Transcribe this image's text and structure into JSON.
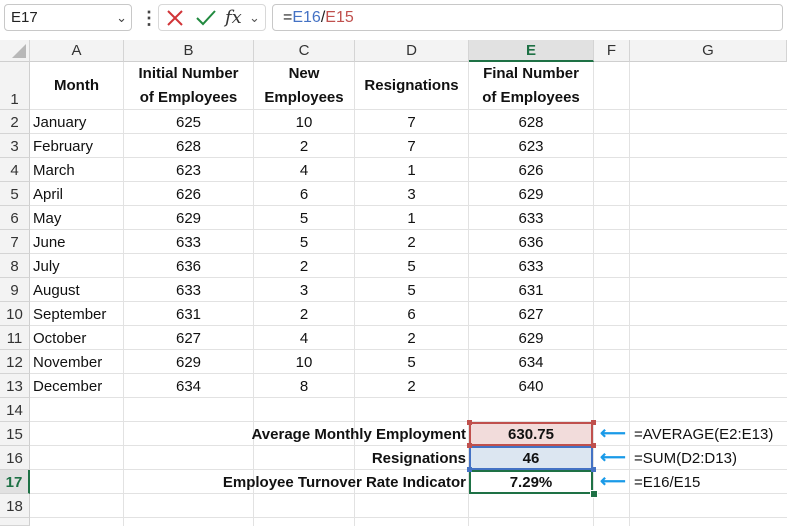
{
  "formula_bar": {
    "name_box": "E17",
    "formula": "=E16/E15",
    "formula_parts": {
      "eq": "=",
      "ref1": "E16",
      "op": "/",
      "ref2": "E15"
    }
  },
  "columns": [
    "A",
    "B",
    "C",
    "D",
    "E",
    "F",
    "G"
  ],
  "rows": [
    "1",
    "2",
    "3",
    "4",
    "5",
    "6",
    "7",
    "8",
    "9",
    "10",
    "11",
    "12",
    "13",
    "14",
    "15",
    "16",
    "17",
    "18"
  ],
  "table": {
    "headers": {
      "month": "Month",
      "initial_l1": "Initial Number",
      "initial_l2": "of Employees",
      "new_l1": "New",
      "new_l2": "Employees",
      "resignations": "Resignations",
      "final_l1": "Final Number",
      "final_l2": "of Employees"
    },
    "data": [
      [
        "January",
        "625",
        "10",
        "7",
        "628"
      ],
      [
        "February",
        "628",
        "2",
        "7",
        "623"
      ],
      [
        "March",
        "623",
        "4",
        "1",
        "626"
      ],
      [
        "April",
        "626",
        "6",
        "3",
        "629"
      ],
      [
        "May",
        "629",
        "5",
        "1",
        "633"
      ],
      [
        "June",
        "633",
        "5",
        "2",
        "636"
      ],
      [
        "July",
        "636",
        "2",
        "5",
        "633"
      ],
      [
        "August",
        "633",
        "3",
        "5",
        "631"
      ],
      [
        "September",
        "631",
        "2",
        "6",
        "627"
      ],
      [
        "October",
        "627",
        "4",
        "2",
        "629"
      ],
      [
        "November",
        "629",
        "10",
        "5",
        "634"
      ],
      [
        "December",
        "634",
        "8",
        "2",
        "640"
      ]
    ]
  },
  "summary": {
    "avg_label": "Average Monthly Employment",
    "avg_value": "630.75",
    "avg_formula": "=AVERAGE(E2:E13)",
    "resign_label": "Resignations",
    "resign_value": "46",
    "resign_formula": "=SUM(D2:D13)",
    "rate_label": "Employee Turnover Rate Indicator",
    "rate_value": "7.29%",
    "rate_formula": "=E16/E15"
  },
  "colors": {
    "avg_fill": "#f2dcdb",
    "avg_border": "#c0504d",
    "resign_fill": "#dce6f1",
    "resign_border": "#4472c4",
    "selection": "#1e7145",
    "arrow": "#1a9ae8",
    "ref1": "#4472c4",
    "ref2": "#c0504d"
  }
}
